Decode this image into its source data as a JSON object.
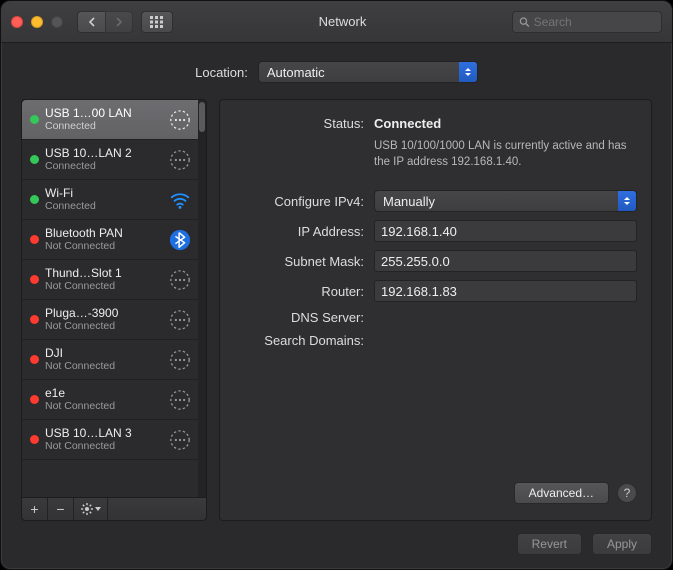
{
  "window": {
    "title": "Network"
  },
  "search": {
    "placeholder": "Search"
  },
  "location": {
    "label": "Location:",
    "value": "Automatic"
  },
  "interfaces": [
    {
      "name": "USB 1…00 LAN",
      "status": "Connected",
      "color": "green",
      "icon": "ethernet",
      "selected": true
    },
    {
      "name": "USB 10…LAN 2",
      "status": "Connected",
      "color": "green",
      "icon": "ethernet",
      "selected": false
    },
    {
      "name": "Wi-Fi",
      "status": "Connected",
      "color": "green",
      "icon": "wifi",
      "selected": false
    },
    {
      "name": "Bluetooth PAN",
      "status": "Not Connected",
      "color": "red",
      "icon": "bluetooth",
      "selected": false
    },
    {
      "name": "Thund…Slot 1",
      "status": "Not Connected",
      "color": "red",
      "icon": "ethernet",
      "selected": false
    },
    {
      "name": "Pluga…-3900",
      "status": "Not Connected",
      "color": "red",
      "icon": "ethernet",
      "selected": false
    },
    {
      "name": "DJI",
      "status": "Not Connected",
      "color": "red",
      "icon": "ethernet",
      "selected": false
    },
    {
      "name": "e1e",
      "status": "Not Connected",
      "color": "red",
      "icon": "ethernet",
      "selected": false
    },
    {
      "name": "USB 10…LAN 3",
      "status": "Not Connected",
      "color": "red",
      "icon": "ethernet",
      "selected": false
    }
  ],
  "detail": {
    "status_label": "Status:",
    "status_value": "Connected",
    "status_desc": "USB 10/100/1000 LAN is currently active and has the IP address 192.168.1.40.",
    "configure_label": "Configure IPv4:",
    "configure_value": "Manually",
    "ip_label": "IP Address:",
    "ip_value": "192.168.1.40",
    "subnet_label": "Subnet Mask:",
    "subnet_value": "255.255.0.0",
    "router_label": "Router:",
    "router_value": "192.168.1.83",
    "dns_label": "DNS Server:",
    "dns_value": "",
    "search_label": "Search Domains:",
    "search_value": ""
  },
  "buttons": {
    "advanced": "Advanced…",
    "revert": "Revert",
    "apply": "Apply"
  }
}
